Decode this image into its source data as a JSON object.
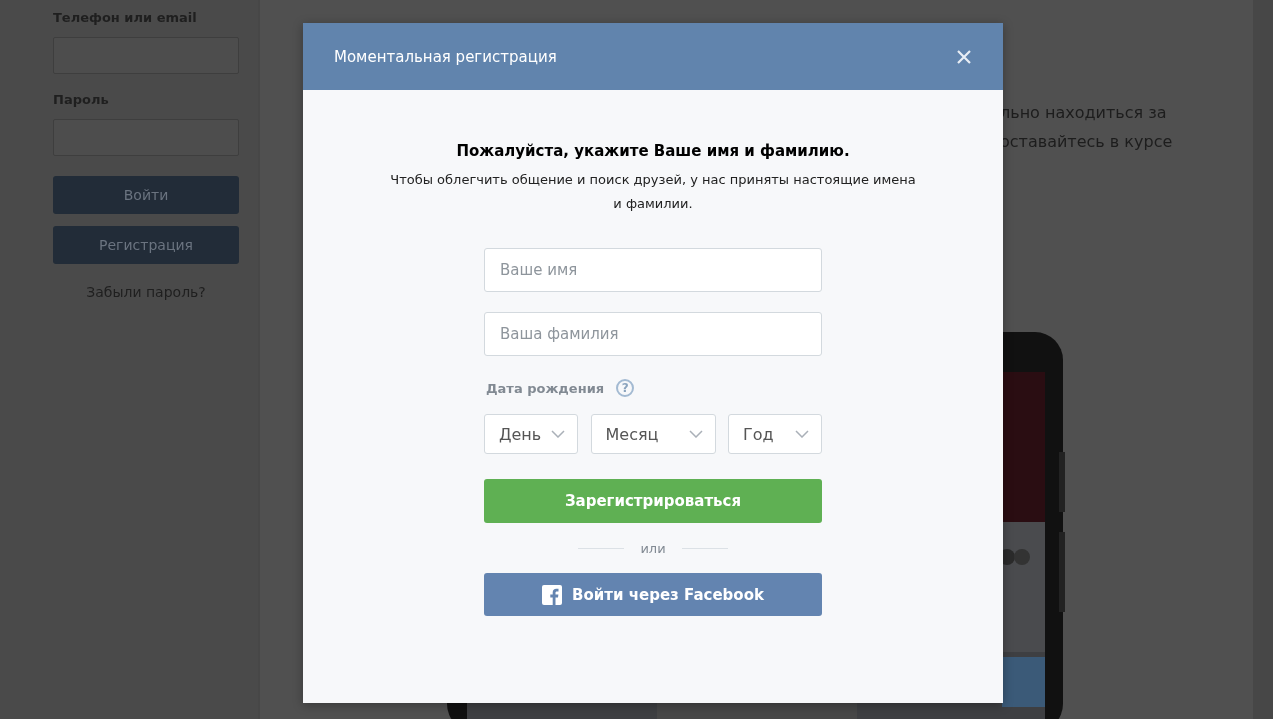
{
  "sidebar": {
    "login_label": "Телефон или email",
    "password_label": "Пароль",
    "login_button": "Войти",
    "register_button": "Регистрация",
    "forgot_link": "Забыли пароль?"
  },
  "page": {
    "lines": [
      "льно находиться за",
      "оставайтесь в курсе"
    ],
    "phone": {
      "kind": "picture"
    }
  },
  "modal": {
    "title": "Моментальная регистрация",
    "heading": "Пожалуйста, укажите Ваше имя и фамилию.",
    "note": "Чтобы облегчить общение и поиск друзей, у нас приняты настоящие имена и фамилии.",
    "fields": [
      {
        "placeholder": "Ваше имя"
      },
      {
        "placeholder": "Ваша фамилия"
      }
    ],
    "birth_label": "Дата рождения",
    "help": "?",
    "selects": [
      {
        "label": "День"
      },
      {
        "label": "Месяц"
      },
      {
        "label": "Год"
      }
    ],
    "submit": "Зарегистрироваться",
    "divider": "или",
    "facebook": "Войти через Facebook"
  }
}
